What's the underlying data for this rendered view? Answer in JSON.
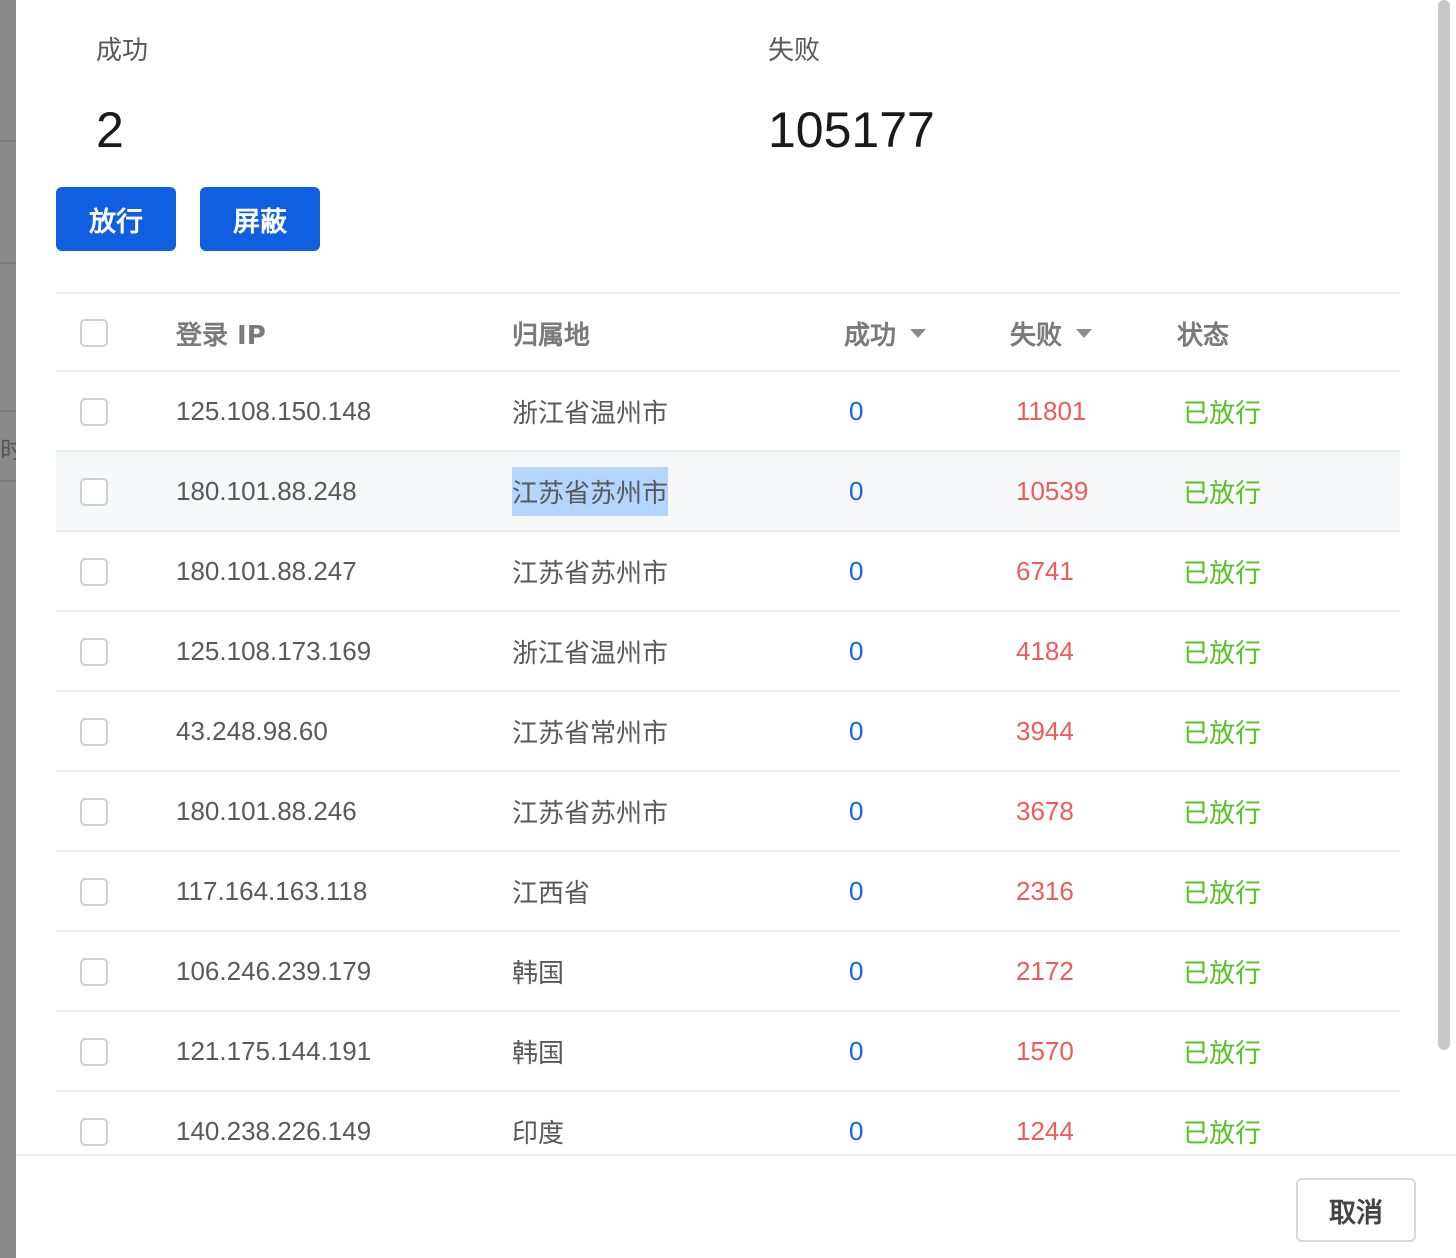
{
  "stats": {
    "success_label": "成功",
    "success_value": "2",
    "fail_label": "失败",
    "fail_value": "105177"
  },
  "actions": {
    "pass_label": "放行",
    "block_label": "屏蔽"
  },
  "table": {
    "columns": {
      "ip": "登录 IP",
      "location": "归属地",
      "success": "成功",
      "fail": "失败",
      "status": "状态"
    },
    "rows": [
      {
        "ip": "125.108.150.148",
        "location": "浙江省温州市",
        "success": "0",
        "fail": "11801",
        "status": "已放行"
      },
      {
        "ip": "180.101.88.248",
        "location": "江苏省苏州市",
        "success": "0",
        "fail": "10539",
        "status": "已放行"
      },
      {
        "ip": "180.101.88.247",
        "location": "江苏省苏州市",
        "success": "0",
        "fail": "6741",
        "status": "已放行"
      },
      {
        "ip": "125.108.173.169",
        "location": "浙江省温州市",
        "success": "0",
        "fail": "4184",
        "status": "已放行"
      },
      {
        "ip": "43.248.98.60",
        "location": "江苏省常州市",
        "success": "0",
        "fail": "3944",
        "status": "已放行"
      },
      {
        "ip": "180.101.88.246",
        "location": "江苏省苏州市",
        "success": "0",
        "fail": "3678",
        "status": "已放行"
      },
      {
        "ip": "117.164.163.118",
        "location": "江西省",
        "success": "0",
        "fail": "2316",
        "status": "已放行"
      },
      {
        "ip": "106.246.239.179",
        "location": "韩国",
        "success": "0",
        "fail": "2172",
        "status": "已放行"
      },
      {
        "ip": "121.175.144.191",
        "location": "韩国",
        "success": "0",
        "fail": "1570",
        "status": "已放行"
      },
      {
        "ip": "140.238.226.149",
        "location": "印度",
        "success": "0",
        "fail": "1244",
        "status": "已放行"
      }
    ]
  },
  "footer": {
    "cancel_label": "取消"
  },
  "background": {
    "partial_text": "时"
  },
  "colors": {
    "primary": "#0f5fe0",
    "success_count": "#1764e0",
    "fail_count": "#ef5b5b",
    "status_passed": "#52c41a",
    "selection": "#b4d5fe"
  }
}
